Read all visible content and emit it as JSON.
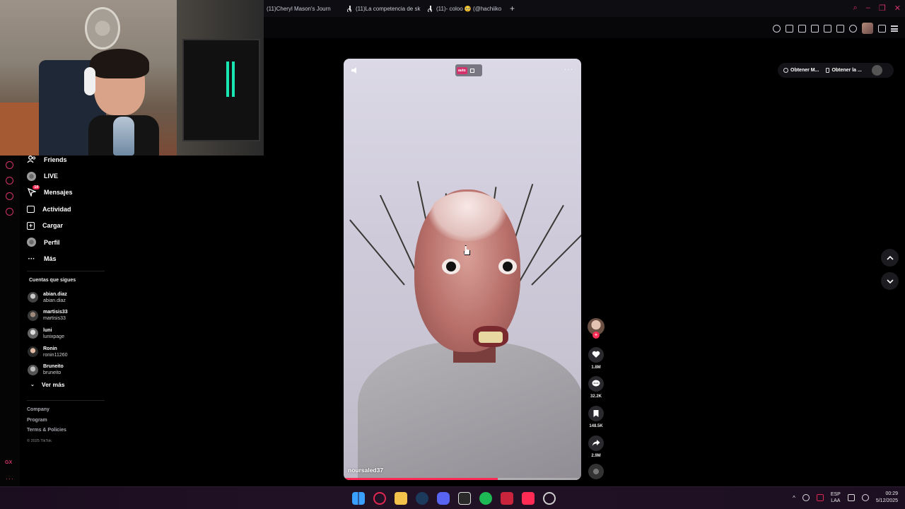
{
  "browser": {
    "tabs": [
      {
        "label": "(11)Cheryl Mason's Journ"
      },
      {
        "label": "(11)La competencia de sk"
      },
      {
        "label": "(11)- coloo 🥺 (@hachiiko"
      }
    ],
    "new_tab": "+"
  },
  "sidebar": {
    "nav": [
      {
        "label": "Friends",
        "icon": "friends-icon"
      },
      {
        "label": "LIVE",
        "icon": "live-icon"
      },
      {
        "label": "Mensajes",
        "icon": "messages-icon",
        "badge": "14"
      },
      {
        "label": "Actividad",
        "icon": "activity-icon"
      },
      {
        "label": "Cargar",
        "icon": "upload-icon"
      },
      {
        "label": "Perfil",
        "icon": "profile-icon"
      },
      {
        "label": "Más",
        "icon": "more-icon"
      }
    ],
    "following_title": "Cuentas que sigues",
    "following": [
      {
        "name": "abian.diaz",
        "username": "abian.diaz"
      },
      {
        "name": "martisis33",
        "username": "martisis33"
      },
      {
        "name": "luni",
        "username": "lunixpage"
      },
      {
        "name": "Ronin",
        "username": "ronin11260"
      },
      {
        "name": "Bruneito",
        "username": "bruneito"
      }
    ],
    "see_more": "Ver más",
    "footer": {
      "links": [
        "Company",
        "Program",
        "Terms & Policies"
      ],
      "copyright": "© 2025 TikTok"
    }
  },
  "rail": {
    "gx": "GX",
    "more": "···"
  },
  "get_buttons": {
    "left": "Obtener M...",
    "right": "Obtener la ..."
  },
  "video": {
    "username": "noursaled37",
    "autoplay_tag": "auto",
    "progress": 0.65
  },
  "actions": {
    "likes": "1.8M",
    "comments": "32.2K",
    "saves": "148.5K",
    "shares": "2.9M",
    "follow": "+"
  },
  "taskbar": {
    "lang_line1": "ESP",
    "lang_line2": "LAA",
    "time": "00:29",
    "date": "5/12/2025"
  },
  "colors": {
    "accent": "#fe2c55",
    "opera_gx": "#d2336b"
  }
}
